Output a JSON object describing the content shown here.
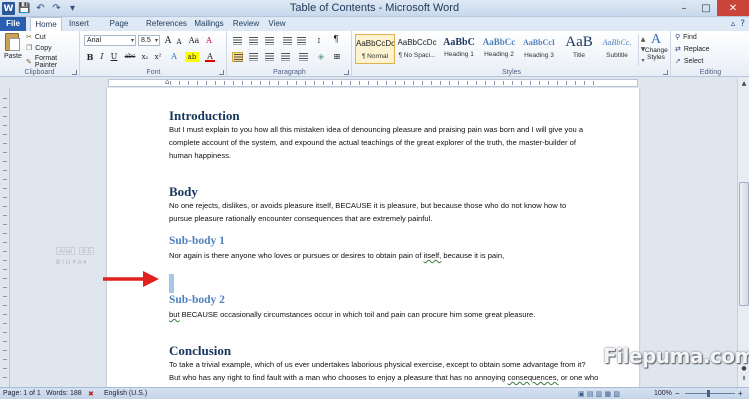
{
  "window": {
    "title": "Table of Contents - Microsoft Word",
    "controls": [
      "–",
      "□",
      "✕"
    ]
  },
  "qat": {
    "word_logo": "W",
    "save": "💾",
    "undo": "↶",
    "redo": "↷",
    "customize": "▾"
  },
  "tabs": [
    {
      "label": "File"
    },
    {
      "label": "Home"
    },
    {
      "label": "Insert"
    },
    {
      "label": "Page Layout"
    },
    {
      "label": "References"
    },
    {
      "label": "Mailings"
    },
    {
      "label": "Review"
    },
    {
      "label": "View"
    }
  ],
  "tab_right": {
    "minimize_ribbon": "▵",
    "help": "?"
  },
  "ribbon": {
    "clipboard": {
      "label": "Clipboard",
      "paste": "Paste",
      "cut": "Cut",
      "copy": "Copy",
      "format_painter": "Format Painter"
    },
    "font": {
      "label": "Font",
      "name": "Arial",
      "size": "8.5",
      "grow": "A",
      "shrink": "A",
      "case": "Aa",
      "clear": "A",
      "bold": "B",
      "italic": "I",
      "underline": "U",
      "strike": "abc",
      "sub": "x₂",
      "sup": "x²",
      "effects": "A",
      "highlight": "ab",
      "color": "A"
    },
    "paragraph": {
      "label": "Paragraph",
      "pilcrow": "¶"
    },
    "styles": {
      "label": "Styles",
      "items": [
        {
          "preview": "AaBbCcDc",
          "name": "¶ Normal"
        },
        {
          "preview": "AaBbCcDc",
          "name": "¶ No Spaci..."
        },
        {
          "preview": "AaBbC",
          "name": "Heading 1"
        },
        {
          "preview": "AaBbCc",
          "name": "Heading 2"
        },
        {
          "preview": "AaBbCcI",
          "name": "Heading 3"
        },
        {
          "preview": "AaB",
          "name": "Title"
        },
        {
          "preview": "AaBbCc.",
          "name": "Subtitle"
        }
      ],
      "change_styles": "Change Styles"
    },
    "editing": {
      "label": "Editing",
      "find": "Find",
      "replace": "Replace",
      "select": "Select"
    }
  },
  "document": {
    "intro_heading": "Introduction",
    "intro_text": "But I must explain to you how all this mistaken idea of denouncing pleasure and praising pain was born and I will give you a complete account of the system, and expound the actual teachings of the great explorer of the truth, the master-builder of human happiness.",
    "body_heading": "Body",
    "body_text": "No one rejects, dislikes, or avoids pleasure itself, BECAUSE it is pleasure, but because those who do not know how to pursue pleasure rationally encounter consequences that are extremely painful.",
    "sub1_heading": "Sub-body 1",
    "sub1_text_a": "Nor again is there anyone who loves or pursues or desires to obtain pain of ",
    "sub1_text_err": "itself,",
    "sub1_text_b": " because it is pain,",
    "sub2_heading": "Sub-body 2",
    "sub2_text_err": "but",
    "sub2_text_b": " BECAUSE occasionally circumstances occur in which toil and pain can procure him some great pleasure.",
    "conclusion_heading": "Conclusion",
    "conclusion_text_a": "To take a trivial example, which of us ever undertakes laborious physical exercise, except to obtain some advantage from it? But who has any right to find fault with a man who chooses to enjoy a pleasure that has no annoying ",
    "conclusion_text_err": "consequences,",
    "conclusion_text_b": " or one who avoids a pain that produces no resultant pleasure?"
  },
  "mini_toolbar": {
    "font": "Arial",
    "size": "8.5",
    "row2": "B I U ≡ A ▾"
  },
  "watermark": "Filepuma.com",
  "statusbar": {
    "page": "Page: 1 of 1",
    "words": "Words: 188",
    "language": "English (U.S.)",
    "zoom": "100%"
  },
  "colors": {
    "file_tab": "#2a5fb0",
    "heading": "#17365d",
    "subheading": "#4f81bd",
    "arrow": "#e0201c"
  }
}
